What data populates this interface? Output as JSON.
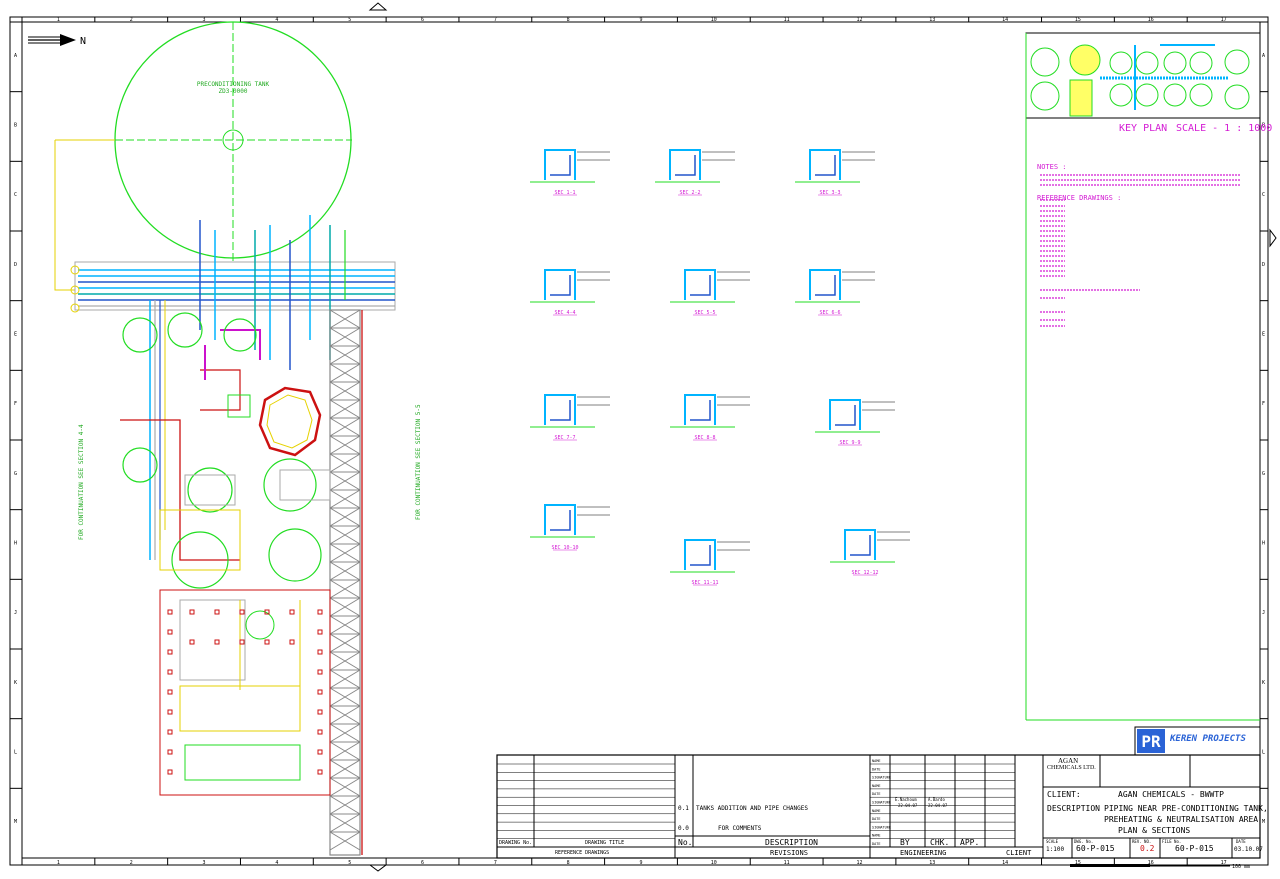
{
  "north_label": "N",
  "tank": {
    "title": "PRECONDITIONING TANK",
    "tag": "ZD3-0000"
  },
  "grid": {
    "cols": [
      "1",
      "2",
      "3",
      "4",
      "5",
      "6",
      "7",
      "8",
      "9",
      "10",
      "11",
      "12",
      "13",
      "14",
      "15",
      "16",
      "17"
    ],
    "rows": [
      "A",
      "B",
      "C",
      "D",
      "E",
      "F",
      "G",
      "H",
      "J",
      "K",
      "L",
      "M"
    ]
  },
  "key_plan": {
    "title": "KEY PLAN",
    "scale": "SCALE - 1 : 1000"
  },
  "notes": {
    "heading": "NOTES :",
    "ref_heading": "REFERENCE DRAWINGS :"
  },
  "sections": [
    {
      "id": "sec-1",
      "label": "SEC 1-1"
    },
    {
      "id": "sec-2",
      "label": "SEC 2-2"
    },
    {
      "id": "sec-3",
      "label": "SEC 3-3"
    },
    {
      "id": "sec-4",
      "label": "SEC 4-4"
    },
    {
      "id": "sec-5",
      "label": "SEC 5-5"
    },
    {
      "id": "sec-6",
      "label": "SEC 6-6"
    },
    {
      "id": "sec-7",
      "label": "SEC 7-7"
    },
    {
      "id": "sec-8",
      "label": "SEC 8-8"
    },
    {
      "id": "sec-9",
      "label": "SEC 9-9"
    },
    {
      "id": "sec-10",
      "label": "SEC 10-10"
    },
    {
      "id": "sec-11",
      "label": "SEC 11-11"
    },
    {
      "id": "sec-12",
      "label": "SEC 12-12"
    }
  ],
  "company": {
    "name": "KEREN PROJECTS"
  },
  "owner": {
    "name": "AGAN",
    "sub": "CHEMICALS LTD."
  },
  "title_block": {
    "client_label": "CLIENT:",
    "client_value": "AGAN CHEMICALS - BWWTP",
    "description_label": "DESCRIPTION",
    "description_lines": [
      "PIPING NEAR PRE-CONDITIONING TANK,",
      "PREHEATING & NEUTRALISATION AREA",
      "PLAN & SECTIONS"
    ],
    "scale_label": "SCALE",
    "scale_value": "1:100",
    "dwg_no_label": "DWG. No.",
    "dwg_no": "60-P-015",
    "rev_no_label": "REV. NO.",
    "rev_no": "0.2",
    "file_label": "FILE No.",
    "file_no": "60-P-015",
    "date_label": "DATE",
    "date": "03.10.07"
  },
  "revisions": {
    "rows": [
      {
        "no": "0.1",
        "desc": "TANKS ADDITION AND PIPE CHANGES"
      },
      {
        "no": "0.0",
        "desc": "FOR COMMENTS"
      }
    ],
    "header_no": "No.",
    "header_desc": "DESCRIPTION",
    "caption": "REVISIONS",
    "by": "BY",
    "chk": "CHK.",
    "app": "APP.",
    "engineering": "ENGINEERING",
    "client": "CLIENT"
  },
  "reference_block": {
    "drawing_no": "DRAWING No.",
    "drawing_title": "DRAWING TITLE",
    "caption": "REFERENCE DRAWINGS"
  },
  "sign_labels": [
    "NAME",
    "DATE",
    "SIGNATURE"
  ],
  "eng_names": {
    "name1": "E.Nachoum",
    "name2": "A.Bardo",
    "date1": "22.04.07",
    "date2": "22.04.07"
  },
  "scale_bar": {
    "end": "100 mm"
  }
}
